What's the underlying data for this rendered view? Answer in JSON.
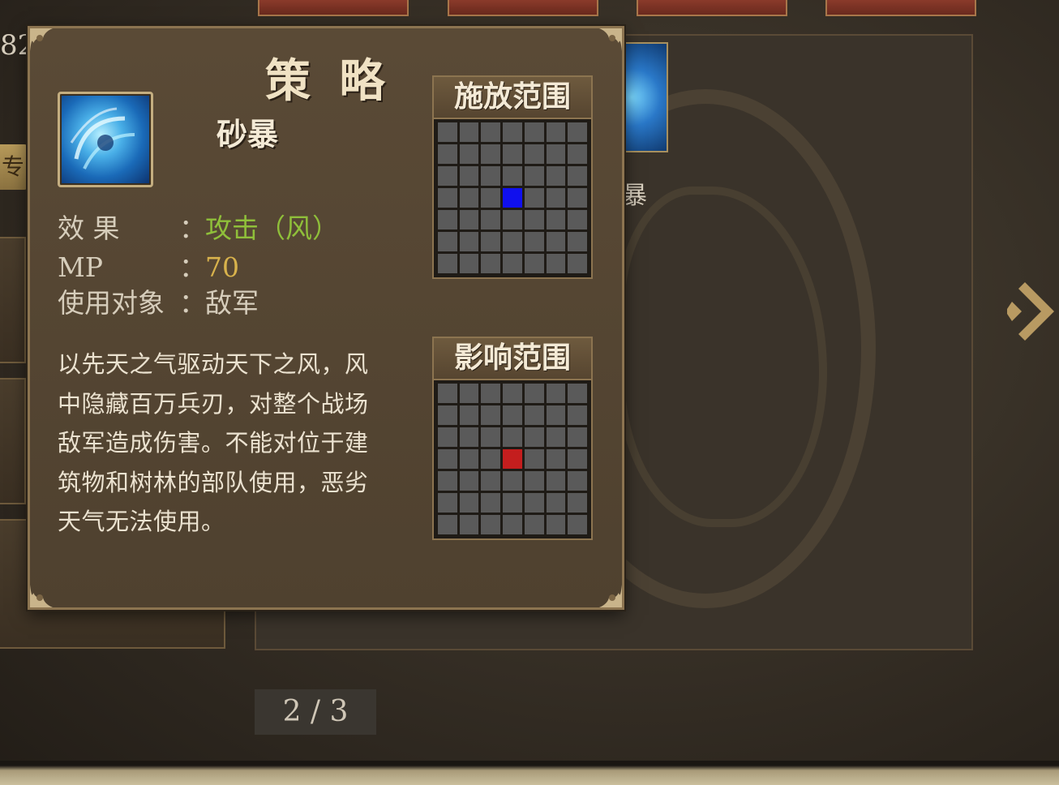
{
  "background": {
    "left_number": "82",
    "left_tab_label": "专",
    "bg_skill_name": "暴",
    "page_indicator": "2 / 3"
  },
  "popup": {
    "title": "策 略",
    "skill_name": "砂暴",
    "skill_icon": "sandstorm-skill-icon",
    "effect_label": "效  果",
    "effect_value": "攻击（风）",
    "mp_label": "MP",
    "mp_value": "70",
    "target_label": "使用对象",
    "target_value": "敌军",
    "colon": "：",
    "description": "以先天之气驱动天下之风，风中隐藏百万兵刃，对整个战场敌军造成伤害。不能对位于建筑物和树林的部队使用，恶劣天气无法使用。",
    "cast_range": {
      "label": "施放范围",
      "rows": 7,
      "cols": 7,
      "highlight": {
        "row": 3,
        "col": 3
      },
      "highlight_color": "#1010ee"
    },
    "effect_range": {
      "label": "影响范围",
      "rows": 7,
      "cols": 7,
      "highlight": {
        "row": 3,
        "col": 3
      },
      "highlight_color": "#c41e1e"
    }
  },
  "colors": {
    "effect_green": "#8fbf3a",
    "mp_gold": "#d8b24c",
    "panel_brown": "#5a4a36"
  }
}
